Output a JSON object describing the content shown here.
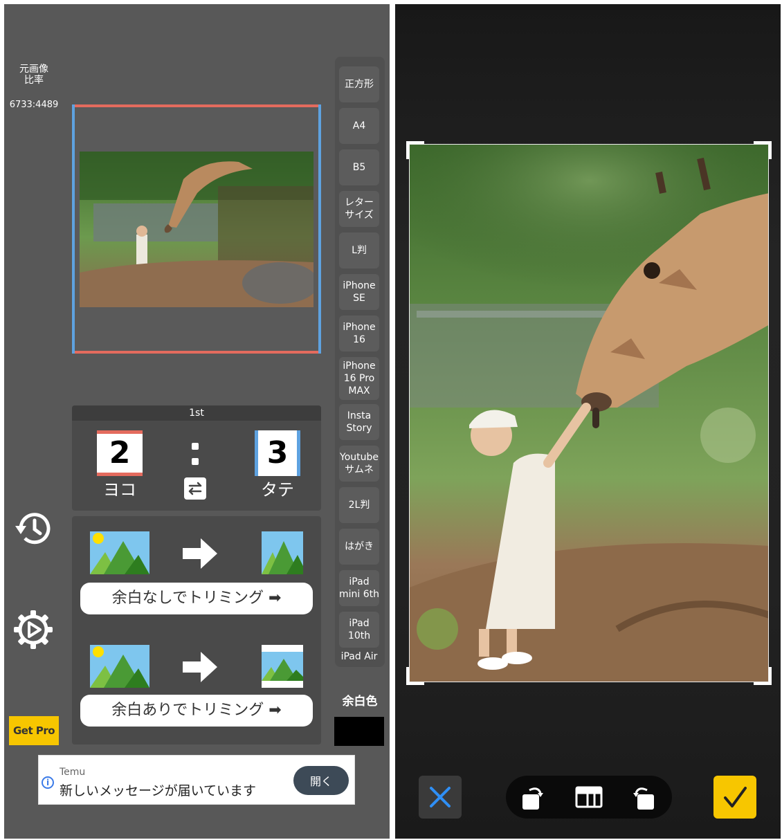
{
  "left": {
    "ratio_title": "元画像\n比率",
    "ratio_value": "6733:4489",
    "step_label": "1st",
    "yoko_value": "2",
    "yoko_label": "ヨコ",
    "tate_value": "3",
    "tate_label": "タテ",
    "trim_no_margin": "余白なしでトリミング ➡",
    "trim_with_margin": "余白ありでトリミング ➡",
    "get_pro": "Get Pro",
    "margin_color_label": "余白色",
    "margin_color": "#000000",
    "presets": [
      "正方形",
      "A4",
      "B5",
      "レター\nサイズ",
      "L判",
      "iPhone\nSE",
      "iPhone\n16",
      "iPhone\n16 Pro\nMAX",
      "Insta\nStory",
      "Youtube\nサムネ",
      "2L判",
      "はがき",
      "iPad\nmini 6th",
      "iPad\n10th",
      "iPad Air"
    ],
    "ad": {
      "brand": "Temu",
      "message": "新しいメッセージが届いています",
      "button": "開く"
    }
  },
  "colors": {
    "accent_red": "#e46b5e",
    "accent_blue": "#5ea2e0",
    "brand_yellow": "#f7c600",
    "cancel_blue": "#2f8ff5"
  },
  "right": {
    "icons": [
      "close-icon",
      "rotate-left-icon",
      "aspect-ratio-icon",
      "rotate-right-icon",
      "check-icon"
    ]
  }
}
